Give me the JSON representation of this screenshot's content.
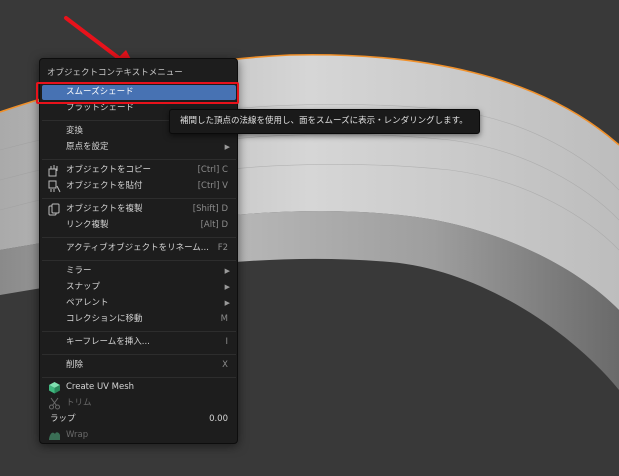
{
  "menu": {
    "title": "オブジェクトコンテキストメニュー",
    "items": {
      "smooth": "スムーズシェード",
      "flat": "フラットシェード",
      "transform": "変換",
      "origin": "原点を設定",
      "copy": "オブジェクトをコピー",
      "copy_sc": "[Ctrl] C",
      "paste": "オブジェクトを貼付",
      "paste_sc": "[Ctrl] V",
      "duplicate": "オブジェクトを複製",
      "duplicate_sc": "[Shift] D",
      "link": "リンク複製",
      "link_sc": "[Alt] D",
      "rename": "アクティブオブジェクトをリネーム...",
      "rename_sc": "F2",
      "mirror": "ミラー",
      "snap": "スナップ",
      "parent": "ペアレント",
      "move_collection": "コレクションに移動",
      "move_collection_sc": "M",
      "keyframe": "キーフレームを挿入...",
      "keyframe_sc": "I",
      "delete": "削除",
      "delete_sc": "X",
      "create_uv": "Create UV Mesh",
      "trim": "トリム",
      "wrap_label": "ラップ",
      "wrap_value": "0.00",
      "wrap": "Wrap"
    },
    "submenu_arrow": "▶"
  },
  "tooltip": {
    "text": "補間した頂点の法線を使用し、面をスムーズに表示・レンダリングします。"
  },
  "colors": {
    "highlight": "#4772b3",
    "annotation_red": "#e8121b",
    "selection_outline": "#f0902a",
    "uv_icon_green": "#3fb87f"
  }
}
